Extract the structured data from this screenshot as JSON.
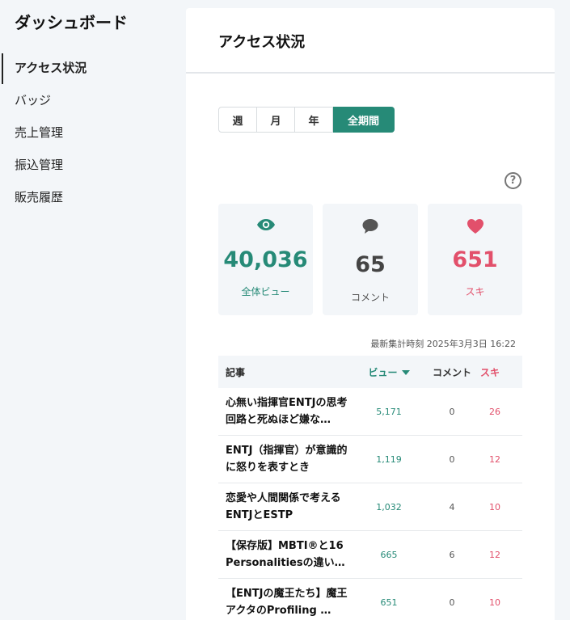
{
  "sidebar": {
    "title": "ダッシュボード",
    "items": [
      {
        "label": "アクセス状況"
      },
      {
        "label": "バッジ"
      },
      {
        "label": "売上管理"
      },
      {
        "label": "振込管理"
      },
      {
        "label": "販売履歴"
      }
    ]
  },
  "main": {
    "title": "アクセス状況",
    "periods": [
      {
        "label": "週"
      },
      {
        "label": "月"
      },
      {
        "label": "年"
      },
      {
        "label": "全期間"
      }
    ],
    "active_period": "全期間",
    "help_icon": "?",
    "stats": {
      "views": {
        "value": "40,036",
        "label": "全体ビュー",
        "icon": "eye-icon"
      },
      "comments": {
        "value": "65",
        "label": "コメント",
        "icon": "speech-bubble-icon"
      },
      "likes": {
        "value": "651",
        "label": "スキ",
        "icon": "heart-icon"
      }
    },
    "updated": "最新集計時刻 2025年3月3日 16:22",
    "table": {
      "headers": {
        "article": "記事",
        "views": "ビュー",
        "comments": "コメント",
        "likes": "スキ"
      },
      "rows": [
        {
          "title": "心無い指揮官ENTJの思考回路と死ぬほど嫌な…",
          "views": "5,171",
          "comments": "0",
          "likes": "26"
        },
        {
          "title": "ENTJ（指揮官）が意識的に怒りを表すとき",
          "views": "1,119",
          "comments": "0",
          "likes": "12"
        },
        {
          "title": "恋愛や人間関係で考えるENTJとESTP",
          "views": "1,032",
          "comments": "4",
          "likes": "10"
        },
        {
          "title": "【保存版】MBTI®と16 Personalitiesの違い…",
          "views": "665",
          "comments": "6",
          "likes": "12"
        },
        {
          "title": "【ENTJの魔王たち】魔王アクタのProfiling …",
          "views": "651",
          "comments": "0",
          "likes": "10"
        }
      ]
    }
  },
  "colors": {
    "accent": "#268a77",
    "likes": "#e2506b",
    "background": "#f3f6f9"
  }
}
